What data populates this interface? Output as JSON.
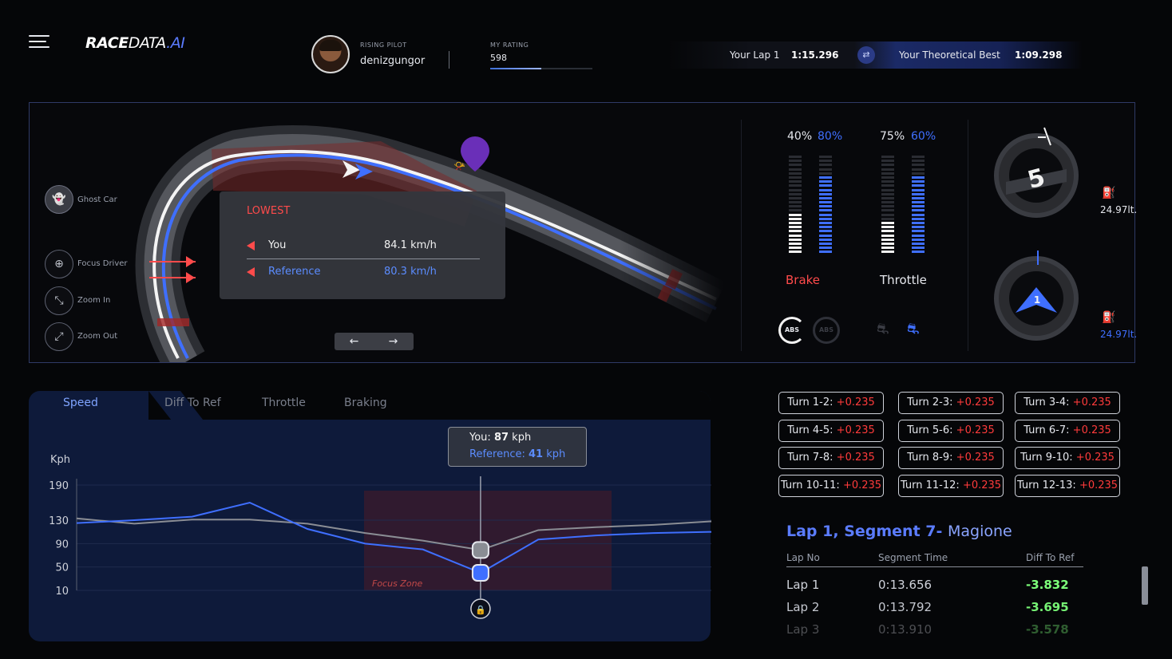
{
  "app": {
    "logo_bold": "RACE",
    "logo_light": "DATA",
    "logo_suffix": ".AI"
  },
  "pilot": {
    "caption": "RISING PILOT",
    "name": "denizgungor"
  },
  "rating": {
    "caption": "MY RATING",
    "value": "598",
    "progress": 0.5
  },
  "laps": {
    "your_lap_label": "Your Lap 1",
    "your_lap_time": "1:15.296",
    "best_label": "Your Theoretical Best",
    "best_time": "1:09.298"
  },
  "side_controls": [
    {
      "label": "Ghost Car"
    },
    {
      "label": "Focus Driver"
    },
    {
      "label": "Zoom In"
    },
    {
      "label": "Zoom Out"
    }
  ],
  "lowest_tooltip": {
    "title": "LOWEST",
    "you_label": "You",
    "you_value": "84.1 km/h",
    "ref_label": "Reference",
    "ref_value": "80.3 km/h"
  },
  "pedals": {
    "brake": {
      "label": "Brake",
      "you_pct": "40%",
      "ref_pct": "80%",
      "you_level": 0.4,
      "ref_level": 0.8
    },
    "throttle": {
      "label": "Throttle",
      "you_pct": "75%",
      "ref_pct": "60%",
      "you_level": 0.35,
      "ref_level": 0.8
    }
  },
  "abs_label": "ABS",
  "fuel": {
    "you": "24.97lt.",
    "ref": "24.97lt."
  },
  "steering": {
    "you_gear": "5",
    "ref_gear": "1"
  },
  "tabs": [
    "Speed",
    "Diff To Ref",
    "Throttle",
    "Braking"
  ],
  "turns": [
    {
      "label": "Turn 1-2:",
      "value": "+0.235"
    },
    {
      "label": "Turn 2-3:",
      "value": "+0.235"
    },
    {
      "label": "Turn 3-4:",
      "value": "+0.235"
    },
    {
      "label": "Turn 4-5:",
      "value": "+0.235"
    },
    {
      "label": "Turn 5-6:",
      "value": "+0.235"
    },
    {
      "label": "Turn 6-7:",
      "value": "+0.235"
    },
    {
      "label": "Turn 7-8:",
      "value": "+0.235"
    },
    {
      "label": "Turn 8-9:",
      "value": "+0.235"
    },
    {
      "label": "Turn 9-10:",
      "value": "+0.235"
    },
    {
      "label": "Turn 10-11:",
      "value": "+0.235"
    },
    {
      "label": "Turn 11-12:",
      "value": "+0.235"
    },
    {
      "label": "Turn 12-13:",
      "value": "+0.235"
    }
  ],
  "segment": {
    "title": "Lap 1, Segment 7-",
    "location": "Magione",
    "headers": [
      "Lap No",
      "Segment Time",
      "Diff To Ref"
    ],
    "rows": [
      {
        "lap": "Lap 1",
        "time": "0:13.656",
        "diff": "-3.832"
      },
      {
        "lap": "Lap 2",
        "time": "0:13.792",
        "diff": "-3.695"
      },
      {
        "lap": "Lap 3",
        "time": "0:13.910",
        "diff": "-3.578"
      }
    ]
  },
  "speed_tooltip": {
    "you_label": "You:",
    "you_value": "87",
    "unit": "kph",
    "ref_label": "Reference:",
    "ref_value": "41"
  },
  "chart_data": {
    "type": "line",
    "ylabel": "Kph",
    "yticks": [
      190,
      130,
      90,
      50,
      10
    ],
    "ylim": [
      10,
      190
    ],
    "focus_zone_label": "Focus Zone",
    "x": [
      0,
      1,
      2,
      3,
      4,
      5,
      6,
      7,
      8,
      9,
      10,
      11
    ],
    "series": [
      {
        "color": "#3f6fff",
        "values": [
          125,
          130,
          136,
          160,
          115,
          90,
          80,
          40,
          97,
          104,
          108,
          110
        ]
      },
      {
        "color": "#8a8d94",
        "values": [
          133,
          124,
          131,
          131,
          124,
          108,
          95,
          79,
          113,
          118,
          122,
          128
        ]
      }
    ],
    "highlight_index": 7
  },
  "colors": {
    "accent": "#3f6fff",
    "brake_red": "#ff4b4b",
    "delta_red": "#ff3b3b",
    "delta_green": "#7dff7a"
  }
}
